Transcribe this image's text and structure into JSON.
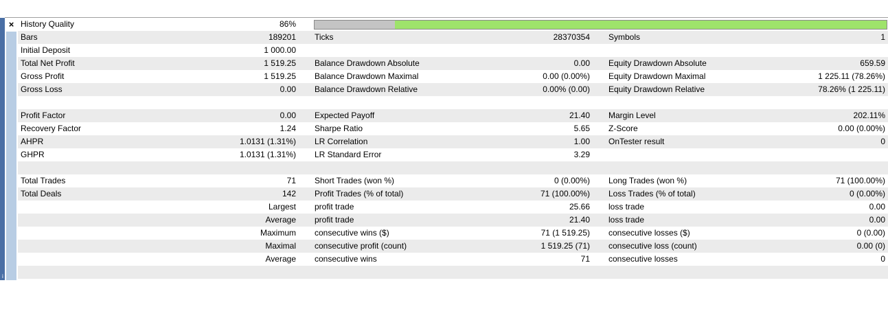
{
  "panel": {
    "close_glyph": "×"
  },
  "history_quality": {
    "label": "History Quality",
    "value": "86%",
    "fraction": 0.86
  },
  "rows": {
    "bars": {
      "c1": "Bars",
      "c2": "189201",
      "c3": "Ticks",
      "c4": "28370354",
      "c5": "Symbols",
      "c6": "1"
    },
    "initial_deposit": {
      "c1": "Initial Deposit",
      "c2": "1 000.00"
    },
    "total_net_profit": {
      "c1": "Total Net Profit",
      "c2": "1 519.25",
      "c3": "Balance Drawdown Absolute",
      "c4": "0.00",
      "c5": "Equity Drawdown Absolute",
      "c6": "659.59"
    },
    "gross_profit": {
      "c1": "Gross Profit",
      "c2": "1 519.25",
      "c3": "Balance Drawdown Maximal",
      "c4": "0.00 (0.00%)",
      "c5": "Equity Drawdown Maximal",
      "c6": "1 225.11 (78.26%)"
    },
    "gross_loss": {
      "c1": "Gross Loss",
      "c2": "0.00",
      "c3": "Balance Drawdown Relative",
      "c4": "0.00% (0.00)",
      "c5": "Equity Drawdown Relative",
      "c6": "78.26% (1 225.11)"
    },
    "profit_factor": {
      "c1": "Profit Factor",
      "c2": "0.00",
      "c3": "Expected Payoff",
      "c4": "21.40",
      "c5": "Margin Level",
      "c6": "202.11%"
    },
    "recovery_factor": {
      "c1": "Recovery Factor",
      "c2": "1.24",
      "c3": "Sharpe Ratio",
      "c4": "5.65",
      "c5": "Z-Score",
      "c6": "0.00 (0.00%)"
    },
    "ahpr": {
      "c1": "AHPR",
      "c2": "1.0131 (1.31%)",
      "c3": "LR Correlation",
      "c4": "1.00",
      "c5": "OnTester result",
      "c6": "0"
    },
    "ghpr": {
      "c1": "GHPR",
      "c2": "1.0131 (1.31%)",
      "c3": "LR Standard Error",
      "c4": "3.29"
    },
    "total_trades": {
      "c1": "Total Trades",
      "c2": "71",
      "c3": "Short Trades (won %)",
      "c4": "0 (0.00%)",
      "c5": "Long Trades (won %)",
      "c6": "71 (100.00%)"
    },
    "total_deals": {
      "c1": "Total Deals",
      "c2": "142",
      "c3": "Profit Trades (% of total)",
      "c4": "71 (100.00%)",
      "c5": "Loss Trades (% of total)",
      "c6": "0 (0.00%)"
    },
    "largest": {
      "c2": "Largest",
      "c3": "profit trade",
      "c4": "25.66",
      "c5": "loss trade",
      "c6": "0.00"
    },
    "average1": {
      "c2": "Average",
      "c3": "profit trade",
      "c4": "21.40",
      "c5": "loss trade",
      "c6": "0.00"
    },
    "maximum": {
      "c2": "Maximum",
      "c3": "consecutive wins ($)",
      "c4": "71 (1 519.25)",
      "c5": "consecutive losses ($)",
      "c6": "0 (0.00)"
    },
    "maximal": {
      "c2": "Maximal",
      "c3": "consecutive profit (count)",
      "c4": "1 519.25 (71)",
      "c5": "consecutive loss (count)",
      "c6": "0.00 (0)"
    },
    "average2": {
      "c2": "Average",
      "c3": "consecutive wins",
      "c4": "71",
      "c5": "consecutive losses",
      "c6": "0"
    }
  }
}
